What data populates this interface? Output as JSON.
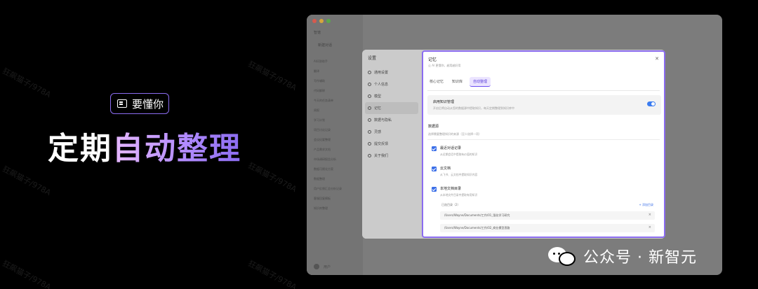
{
  "promo": {
    "badge_label": "要懂你",
    "headline_plain": "定期",
    "headline_highlight": "自动整理",
    "accent_color": "#8b6cf0"
  },
  "app": {
    "sidebar_title": "智谱",
    "new_chat": "新建对话",
    "history_items": [
      "AI问答助手",
      "翻译",
      "写作辅助",
      "代码解释",
      "今天的任务清单",
      "周报",
      "学习计划",
      "项目讨论记录",
      "会议纪要整理",
      "产品需求文档",
      "市场调研报告分析",
      "数据可视化方案",
      "数据整理",
      "用户反馈汇总分析记录",
      "客服回复模板",
      "知识库整理"
    ],
    "footer_user": "用户"
  },
  "settings": {
    "title": "设置",
    "nav_items": [
      {
        "label": "通用设置",
        "icon": "gear-icon"
      },
      {
        "label": "个人信息",
        "icon": "user-icon"
      },
      {
        "label": "模型",
        "icon": "model-icon"
      },
      {
        "label": "记忆",
        "icon": "memory-icon",
        "active": true
      },
      {
        "label": "数据与隐私",
        "icon": "shield-icon"
      },
      {
        "label": "灵感",
        "icon": "bulb-icon"
      },
      {
        "label": "提交反馈",
        "icon": "feedback-icon"
      },
      {
        "label": "关于我们",
        "icon": "info-icon"
      }
    ]
  },
  "memory": {
    "title": "记忆",
    "subtitle": "让 AI 更懂你，越用越好用",
    "tabs": [
      "核心记忆",
      "知识库",
      "自动整理"
    ],
    "active_tab": "自动整理",
    "knowledge_toggle": {
      "label": "启用知识管理",
      "description": "开启后将自动从您的数据源中提取知识，每天定期整理到知识库中",
      "enabled": true
    },
    "sources_title": "数据源",
    "sources_subtitle": "选择需要整理知识的来源（至少选择一项）",
    "sources": [
      {
        "name": "最近对话记录",
        "desc": "从近期会话中提取有价值的知识",
        "checked": true
      },
      {
        "name": "云文档",
        "desc": "从飞书、云文档中提取知识内容",
        "checked": true
      },
      {
        "name": "本地文档目录",
        "desc": "从本地文件目录中提取有用知识",
        "checked": true
      }
    ],
    "dir_header": "已选目录（2）",
    "add_dir": "+ 添加目录",
    "directories": [
      "/Users/Wayne/Documents/工作/01_强化学习研究",
      "/Users/Wayne/Documents/工作/02_商业模型思路"
    ]
  },
  "watermark_text": "狂飙猫子/978A",
  "wechat": {
    "text": "公众号 · 新智元"
  }
}
